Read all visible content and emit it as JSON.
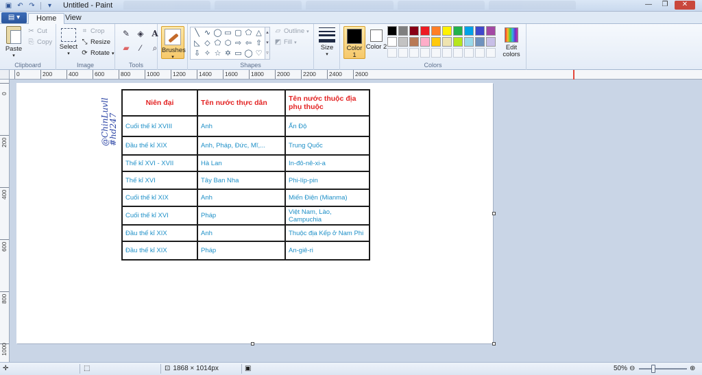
{
  "window": {
    "title": "Untitled - Paint"
  },
  "ribbon_tabs": [
    {
      "label": "Home"
    },
    {
      "label": "View"
    }
  ],
  "groups": {
    "clipboard": {
      "label": "Clipboard",
      "paste": "Paste",
      "cut": "Cut",
      "copy": "Copy"
    },
    "image": {
      "label": "Image",
      "select": "Select",
      "crop": "Crop",
      "resize": "Resize",
      "rotate": "Rotate"
    },
    "tools": {
      "label": "Tools"
    },
    "brushes": {
      "label": "Brushes"
    },
    "shapes": {
      "label": "Shapes",
      "outline": "Outline",
      "fill": "Fill"
    },
    "size": {
      "label": "Size"
    },
    "colors": {
      "label": "Colors",
      "color1": "Color 1",
      "color1_value": "#000000",
      "color2": "Color 2",
      "color2_value": "#ffffff",
      "edit": "Edit colors",
      "palette_row1": [
        "#000000",
        "#7f7f7f",
        "#880015",
        "#ed1c24",
        "#ff7f27",
        "#fff200",
        "#22b14c",
        "#00a2e8",
        "#3f48cc",
        "#a349a4"
      ],
      "palette_row2": [
        "#ffffff",
        "#c3c3c3",
        "#b97a57",
        "#ffaec9",
        "#ffc90e",
        "#efe4b0",
        "#b5e61d",
        "#99d9ea",
        "#7092be",
        "#c8bfe7"
      ]
    }
  },
  "ruler": {
    "h_labels": [
      "0",
      "200",
      "400",
      "600",
      "800",
      "1000",
      "1200",
      "1400",
      "1600",
      "1800",
      "2000",
      "2200",
      "2400",
      "2600"
    ],
    "v_labels": [
      "0",
      "200",
      "400",
      "600",
      "800",
      "1000"
    ]
  },
  "canvas": {
    "watermark_line1": "@ChinLuvll",
    "watermark_line2": "#hd247",
    "table": {
      "headers": [
        "Niên đại",
        "Tên nước thực dân",
        "Tên nước thuộc địa phụ thuộc"
      ],
      "rows": [
        [
          "Cuối thế kỉ XVIII",
          "Anh",
          "Ấn Độ"
        ],
        [
          "Đầu thế kỉ XIX",
          "Anh, Pháp, Đức, Mĩ,...",
          "Trung Quốc"
        ],
        [
          "Thế kỉ XVI - XVII",
          "Hà Lan",
          "In-đô-nê-xi-a"
        ],
        [
          "Thế kỉ XVI",
          "Tây Ban Nha",
          "Phi-líp-pin"
        ],
        [
          "Cuối thế kỉ XIX",
          "Anh",
          "Miến Điện (Mianma)"
        ],
        [
          "Cuối thế kỉ XVI",
          "Pháp",
          "Việt Nam, Lào, Campuchia"
        ],
        [
          "Đầu thế kỉ XIX",
          "Anh",
          "Thuộc địa Kếp ở Nam Phi"
        ],
        [
          "Đầu thế kỉ XIX",
          "Pháp",
          "An-giê-ri"
        ]
      ]
    }
  },
  "status": {
    "dimensions": "1868 × 1014px",
    "zoom": "50%"
  }
}
